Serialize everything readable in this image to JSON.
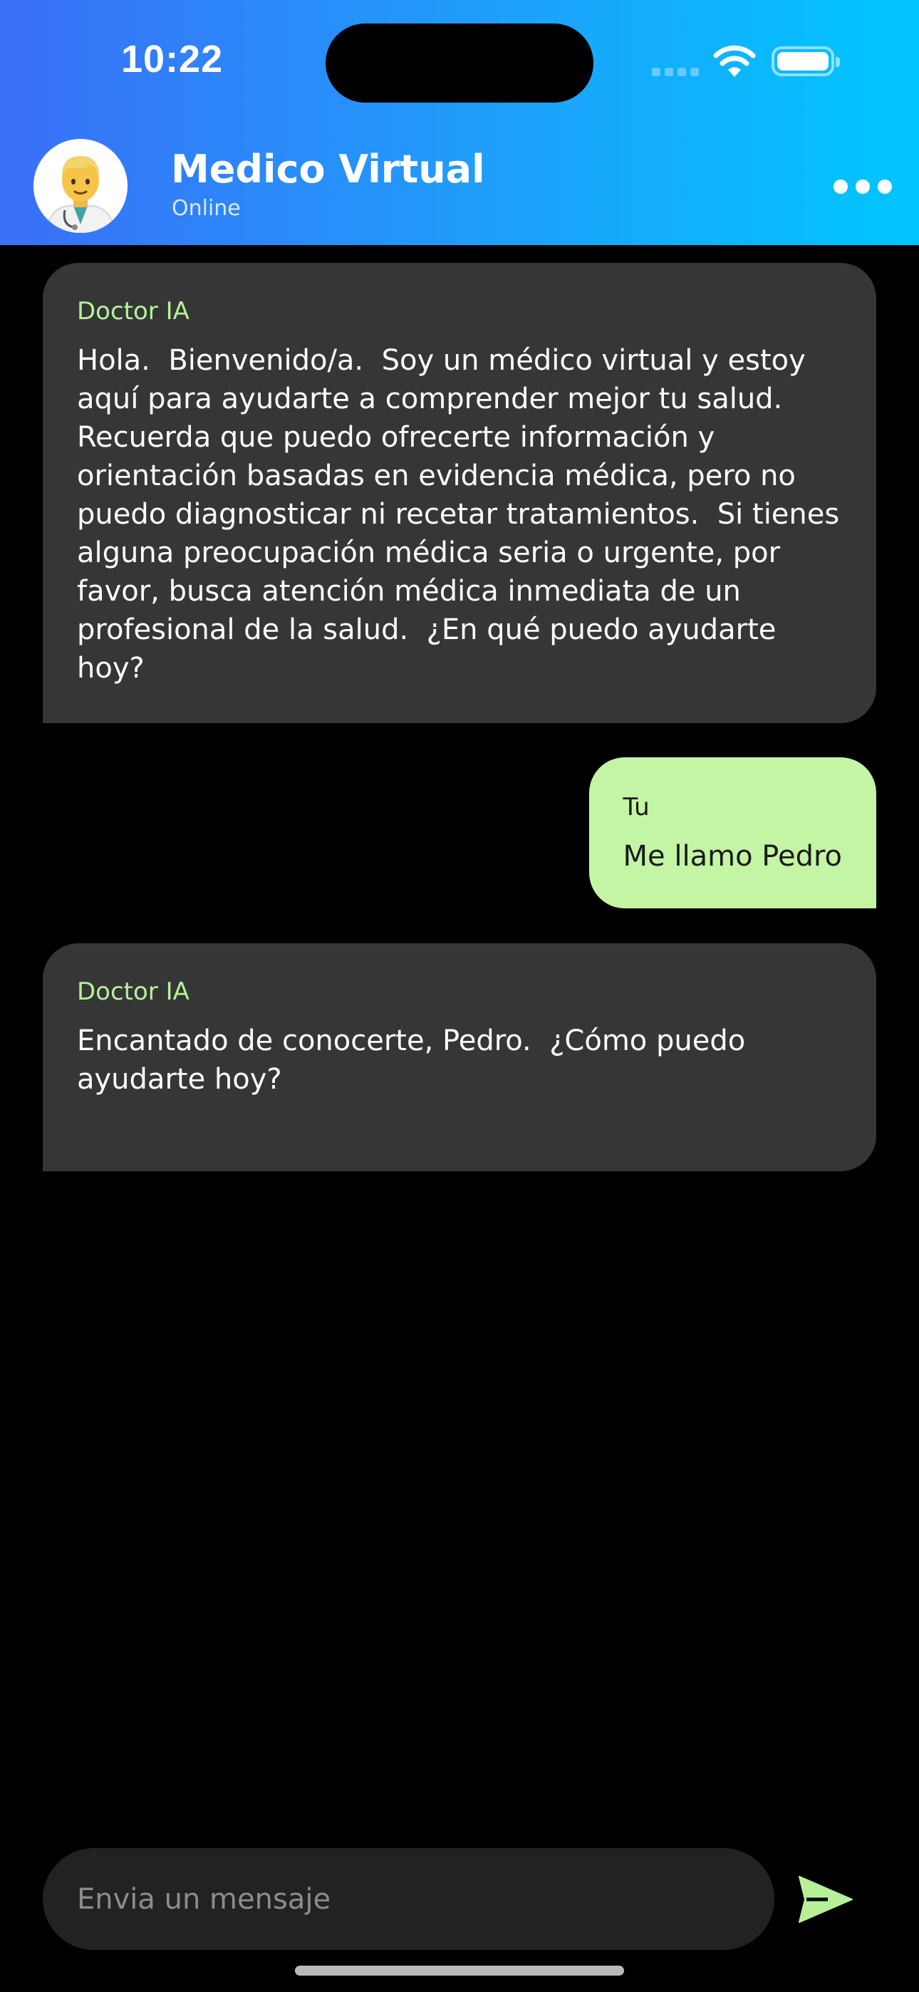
{
  "status_bar": {
    "time": "10:22"
  },
  "header": {
    "avatar_icon": "doctor-emoji-icon",
    "title": "Medico Virtual",
    "status": "Online",
    "menu_icon": "more-horizontal-icon"
  },
  "messages": [
    {
      "sender": "Doctor IA",
      "role": "bot",
      "text": "Hola.  Bienvenido/a.  Soy un médico virtual y estoy aquí para ayudarte a comprender mejor tu salud.  Recuerda que puedo ofrecerte información y orientación basadas en evidencia médica, pero no puedo diagnosticar ni recetar tratamientos.  Si tienes alguna preocupación médica seria o urgente, por favor, busca atención médica inmediata de un profesional de la salud.  ¿En qué puedo ayudarte hoy?"
    },
    {
      "sender": "Tu",
      "role": "user",
      "text": "Me llamo Pedro"
    },
    {
      "sender": "Doctor IA",
      "role": "bot",
      "text": "Encantado de conocerte, Pedro.  ¿Cómo puedo ayudarte hoy?"
    }
  ],
  "composer": {
    "placeholder": "Envia un mensaje",
    "value": "",
    "send_icon": "send-icon"
  },
  "colors": {
    "header_gradient_start": "#3a6ff7",
    "header_gradient_end": "#00c6ff",
    "bot_bubble": "#363636",
    "user_bubble": "#c3f5a5",
    "accent_green": "#b6f19a",
    "background": "#000000"
  }
}
